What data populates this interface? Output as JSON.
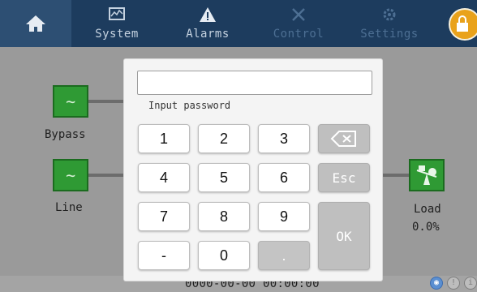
{
  "nav": {
    "tabs": [
      {
        "label": "System",
        "icon": "chart-monitor-icon"
      },
      {
        "label": "Alarms",
        "icon": "warning-icon"
      },
      {
        "label": "Control",
        "icon": "tools-icon"
      },
      {
        "label": "Settings",
        "icon": "gear-icon"
      }
    ]
  },
  "diagram": {
    "bypass_label": "Bypass",
    "line_label": "Line",
    "load_label": "Load",
    "load_value": "0.0%"
  },
  "keypad": {
    "input_value": "",
    "input_label": "Input password",
    "keys": [
      "1",
      "2",
      "3",
      "4",
      "5",
      "6",
      "7",
      "8",
      "9",
      "-",
      "0",
      "."
    ],
    "esc_label": "Esc",
    "ok_label": "OK"
  },
  "status": {
    "datetime": "0000-00-00 00:00:00"
  },
  "colors": {
    "nav_bg": "#1d3c5e",
    "nav_active_indicator": "#3a6ea8",
    "module_green": "#2f9a34",
    "lock_orange": "#e9a21b"
  }
}
